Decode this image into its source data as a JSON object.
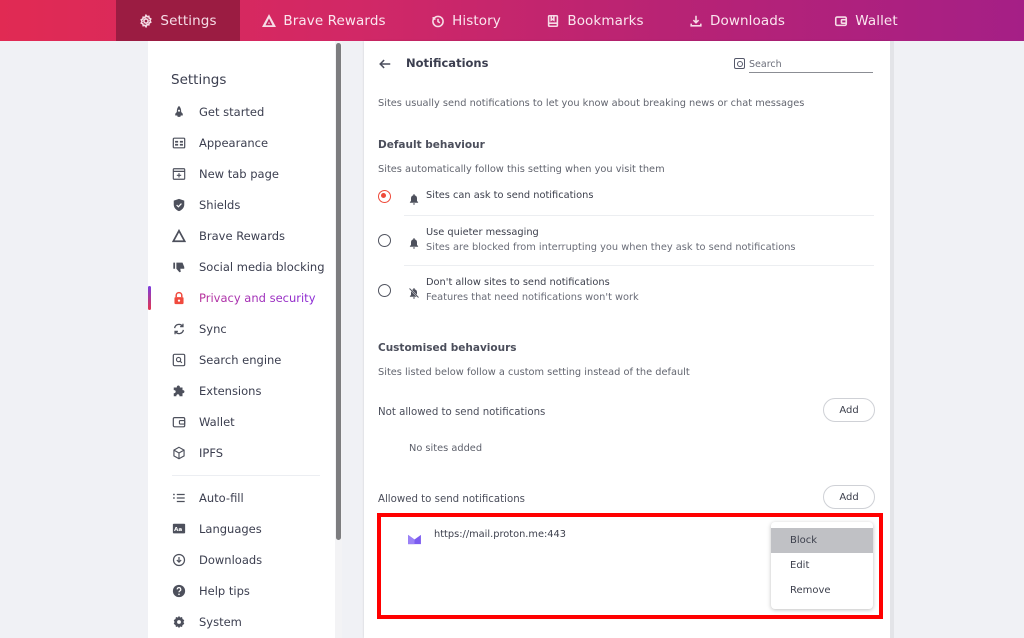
{
  "topbar": {
    "tabs": [
      {
        "id": "settings",
        "label": "Settings",
        "icon": "gear-icon",
        "active": true
      },
      {
        "id": "rewards",
        "label": "Brave Rewards",
        "icon": "bat-triangle-icon",
        "active": false
      },
      {
        "id": "history",
        "label": "History",
        "icon": "history-clock-icon",
        "active": false
      },
      {
        "id": "bookmarks",
        "label": "Bookmarks",
        "icon": "bookmark-icon",
        "active": false
      },
      {
        "id": "downloads",
        "label": "Downloads",
        "icon": "download-icon",
        "active": false
      },
      {
        "id": "wallet",
        "label": "Wallet",
        "icon": "wallet-icon",
        "active": false
      }
    ],
    "colors": {
      "gradient_start": "#e12a53",
      "gradient_end": "#a51f86",
      "active_tab": "#9b1c42"
    }
  },
  "sidebar": {
    "title": "Settings",
    "items": [
      {
        "label": "Get started",
        "icon": "rocket-icon"
      },
      {
        "label": "Appearance",
        "icon": "appearance-icon"
      },
      {
        "label": "New tab page",
        "icon": "new-tab-icon"
      },
      {
        "label": "Shields",
        "icon": "shield-icon"
      },
      {
        "label": "Brave Rewards",
        "icon": "rewards-triangle-icon"
      },
      {
        "label": "Social media blocking",
        "icon": "thumbs-down-icon"
      },
      {
        "label": "Privacy and security",
        "icon": "lock-icon",
        "active": true
      },
      {
        "label": "Sync",
        "icon": "sync-icon"
      },
      {
        "label": "Search engine",
        "icon": "search-engine-icon"
      },
      {
        "label": "Extensions",
        "icon": "puzzle-icon"
      },
      {
        "label": "Wallet",
        "icon": "wallet-icon"
      },
      {
        "label": "IPFS",
        "icon": "cube-icon"
      }
    ],
    "items_secondary": [
      {
        "label": "Auto-fill",
        "icon": "list-icon"
      },
      {
        "label": "Languages",
        "icon": "language-icon"
      },
      {
        "label": "Downloads",
        "icon": "download-circle-icon"
      },
      {
        "label": "Help tips",
        "icon": "help-icon"
      },
      {
        "label": "System",
        "icon": "gear-icon"
      }
    ],
    "active_color": "#a023c2",
    "lock_color": "#f04a3e"
  },
  "main": {
    "title": "Notifications",
    "search_placeholder": "Search",
    "intro": "Sites usually send notifications to let you know about breaking news or chat messages",
    "default_behaviour": {
      "heading": "Default behaviour",
      "description": "Sites automatically follow this setting when you visit them",
      "options": [
        {
          "title": "Sites can ask to send notifications",
          "subtitle": "",
          "selected": true,
          "icon": "bell-icon"
        },
        {
          "title": "Use quieter messaging",
          "subtitle": "Sites are blocked from interrupting you when they ask to send notifications",
          "selected": false,
          "icon": "bell-icon"
        },
        {
          "title": "Don't allow sites to send notifications",
          "subtitle": "Features that need notifications won't work",
          "selected": false,
          "icon": "bell-off-icon"
        }
      ]
    },
    "customised": {
      "heading": "Customised behaviours",
      "description": "Sites listed below follow a custom setting instead of the default",
      "not_allowed": {
        "label": "Not allowed to send notifications",
        "add_label": "Add",
        "empty_text": "No sites added"
      },
      "allowed": {
        "label": "Allowed to send notifications",
        "add_label": "Add",
        "sites": [
          {
            "url": "https://mail.proton.me:443",
            "favicon": "proton-mail-icon"
          }
        ]
      }
    },
    "context_menu": {
      "items": [
        {
          "label": "Block",
          "hovered": true
        },
        {
          "label": "Edit",
          "hovered": false
        },
        {
          "label": "Remove",
          "hovered": false
        }
      ]
    },
    "highlight_color": "#ff0000",
    "radio_color": "#ee4a3a"
  }
}
